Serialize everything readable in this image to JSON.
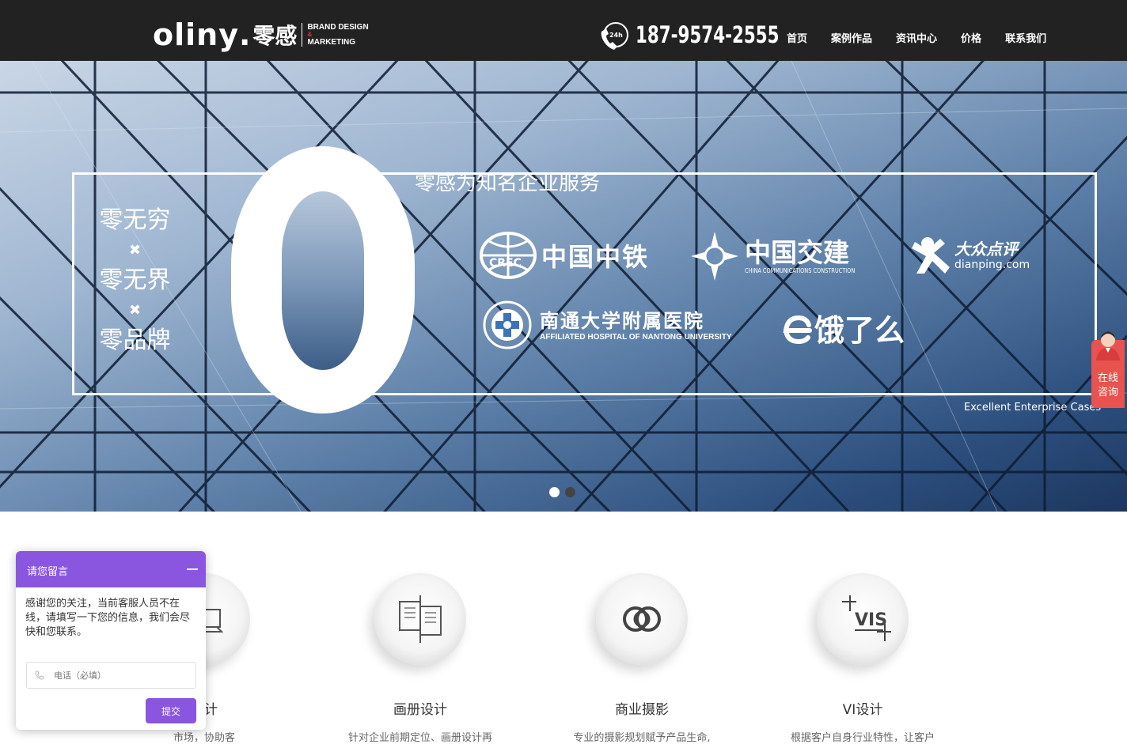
{
  "header": {
    "logo_text": "oliny",
    "logo_dot": ".",
    "logo_cn": "零感",
    "logo_tag_line1": "BRAND DESIGN",
    "logo_tag_amp": "&",
    "logo_tag_line2": "MARKETING",
    "phone_badge": "24h",
    "phone_number": "187-9574-2555",
    "nav": [
      "首页",
      "案例作品",
      "资讯中心",
      "价格",
      "联系我们"
    ]
  },
  "hero": {
    "title": "零感为知名企业服务",
    "subtitle": "Excellent Enterprise Cases",
    "slogans": [
      "零无穷",
      "零无界",
      "零品牌"
    ],
    "slogan_separator": "✖",
    "brands": {
      "crcc": "中国中铁",
      "crcc_badge": "CREC",
      "cccc": "中国交建",
      "cccc_sub": "CHINA COMMUNICATIONS CONSTRUCTION",
      "dianping": "大众点评",
      "dianping_sub": "dianping.com",
      "nantong": "南通大学附属医院",
      "nantong_sub": "AFFILIATED HOSPITAL OF NANTONG UNIVERSITY",
      "eleme": "饿了么"
    },
    "slider": {
      "count": 2,
      "active_index": 0
    }
  },
  "services": [
    {
      "title": "设计",
      "desc": "市场，协助客"
    },
    {
      "title": "画册设计",
      "desc": "针对企业前期定位、画册设计再"
    },
    {
      "title": "商业摄影",
      "desc": "专业的摄影规划赋予产品生命,"
    },
    {
      "title": "VI设计",
      "desc": "根据客户自身行业特性，让客户",
      "icon_text": "VIS"
    }
  ],
  "side_chat": {
    "line1": "在线",
    "line2": "咨询"
  },
  "message_box": {
    "title": "请您留言",
    "text": "感谢您的关注，当前客服人员不在线，请填写一下您的信息，我们会尽快和您联系。",
    "phone_placeholder": "电话（必填）",
    "submit_label": "提交"
  },
  "colors": {
    "header_bg": "#222222",
    "accent_purple": "#8a56e0",
    "chat_red": "#e8534f"
  }
}
